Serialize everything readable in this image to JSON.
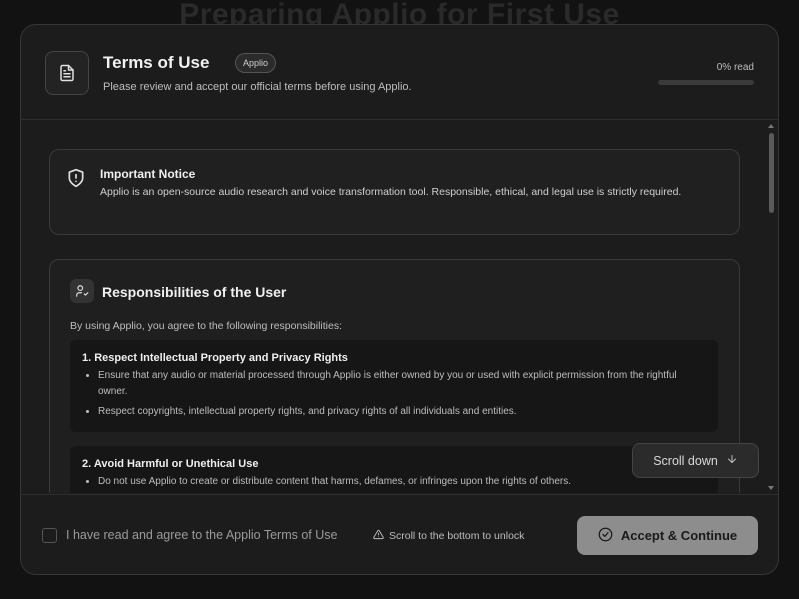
{
  "background": {
    "title": "Preparing Applio for First Use"
  },
  "header": {
    "title": "Terms of Use",
    "badge": "Applio",
    "subtitle": "Please review and accept our official terms before using Applio.",
    "read_label": "0% read",
    "read_progress": 0
  },
  "notice": {
    "title": "Important Notice",
    "text": "Applio is an open-source audio research and voice transformation tool. Responsible, ethical, and legal use is strictly required."
  },
  "responsibilities": {
    "title": "Responsibilities of the User",
    "intro": "By using Applio, you agree to the following responsibilities:",
    "items": [
      {
        "title": "1. Respect Intellectual Property and Privacy Rights",
        "bullets": [
          "Ensure that any audio or material processed through Applio is either owned by you or used with explicit permission from the rightful owner.",
          "Respect copyrights, intellectual property rights, and privacy rights of all individuals and entities."
        ]
      },
      {
        "title": "2. Avoid Harmful or Unethical Use",
        "bullets": [
          "Do not use Applio to create or distribute content that harms, defames, or infringes upon the rights of others."
        ]
      }
    ]
  },
  "scroll_button": {
    "label": "Scroll down"
  },
  "footer": {
    "agree_label": "I have read and agree to the Applio Terms of Use",
    "unlock_hint": "Scroll to the bottom to unlock",
    "accept_label": "Accept & Continue"
  }
}
